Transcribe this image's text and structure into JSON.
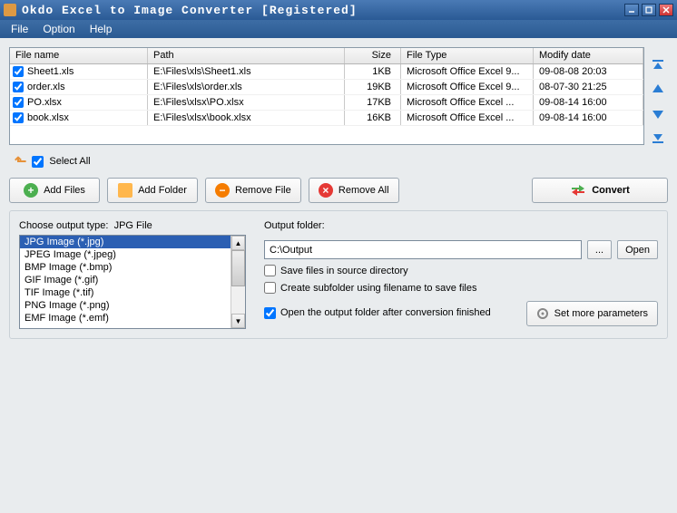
{
  "window": {
    "title": "Okdo Excel to Image Converter [Registered]"
  },
  "menu": {
    "file": "File",
    "option": "Option",
    "help": "Help"
  },
  "grid": {
    "headers": {
      "name": "File name",
      "path": "Path",
      "size": "Size",
      "type": "File Type",
      "date": "Modify date"
    },
    "rows": [
      {
        "checked": true,
        "name": "Sheet1.xls",
        "path": "E:\\Files\\xls\\Sheet1.xls",
        "size": "1KB",
        "type": "Microsoft Office Excel 9...",
        "date": "09-08-08 20:03"
      },
      {
        "checked": true,
        "name": "order.xls",
        "path": "E:\\Files\\xls\\order.xls",
        "size": "19KB",
        "type": "Microsoft Office Excel 9...",
        "date": "08-07-30 21:25"
      },
      {
        "checked": true,
        "name": "PO.xlsx",
        "path": "E:\\Files\\xlsx\\PO.xlsx",
        "size": "17KB",
        "type": "Microsoft Office Excel ...",
        "date": "09-08-14 16:00"
      },
      {
        "checked": true,
        "name": "book.xlsx",
        "path": "E:\\Files\\xlsx\\book.xlsx",
        "size": "16KB",
        "type": "Microsoft Office Excel ...",
        "date": "09-08-14 16:00"
      }
    ]
  },
  "selectAll": {
    "checked": true,
    "label": "Select All"
  },
  "buttons": {
    "addFiles": "Add Files",
    "addFolder": "Add Folder",
    "removeFile": "Remove File",
    "removeAll": "Remove All",
    "convert": "Convert"
  },
  "output": {
    "chooseLabel": "Choose output type:",
    "chooseCurrent": "JPG File",
    "types": [
      "JPG Image (*.jpg)",
      "JPEG Image (*.jpeg)",
      "BMP Image (*.bmp)",
      "GIF Image (*.gif)",
      "TIF Image (*.tif)",
      "PNG Image (*.png)",
      "EMF Image (*.emf)"
    ],
    "selectedIndex": 0,
    "folderLabel": "Output folder:",
    "folderValue": "C:\\Output",
    "browse": "...",
    "open": "Open",
    "opt1": {
      "checked": false,
      "label": "Save files in source directory"
    },
    "opt2": {
      "checked": false,
      "label": "Create subfolder using filename to save files"
    },
    "opt3": {
      "checked": true,
      "label": "Open the output folder after conversion finished"
    },
    "setMore": "Set more parameters"
  }
}
